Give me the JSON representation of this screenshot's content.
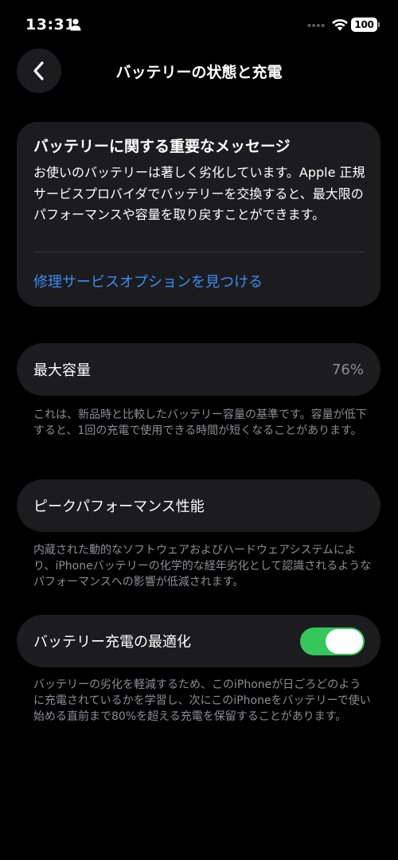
{
  "status_bar": {
    "time": "13:31",
    "battery_level": "100",
    "icons": [
      "person-icon",
      "signal-dots-icon",
      "wifi-icon",
      "battery-icon"
    ]
  },
  "nav": {
    "title": "バッテリーの状態と充電",
    "back_icon": "chevron-left-icon"
  },
  "message_card": {
    "title": "バッテリーに関する重要なメッセージ",
    "body": "お使いのバッテリーは著しく劣化しています。Apple 正規サービスプロバイダでバッテリーを交換すると、最大限のパフォーマンスや容量を取り戻すことができます。",
    "link": "修理サービスオプションを見つける"
  },
  "capacity": {
    "label": "最大容量",
    "value": "76%",
    "note": "これは、新品時と比較したバッテリー容量の基準です。容量が低下すると、1回の充電で使用できる時間が短くなることがあります。"
  },
  "peak_performance": {
    "label": "ピークパフォーマンス性能",
    "note": "内蔵された動的なソフトウェアおよびハードウェアシステムにより、iPhoneバッテリーの化学的な経年劣化として認識されるようなパフォーマンスへの影響が低減されます。"
  },
  "optimization": {
    "label": "バッテリー充電の最適化",
    "enabled": true,
    "note": "バッテリーの劣化を軽減するため、このiPhoneが日ごろどのように充電されているかを学習し、次にこのiPhoneをバッテリーで使い始める直前まで80%を超える充電を保留することがあります。"
  },
  "colors": {
    "background": "#000000",
    "card": "#1c1c1e",
    "link": "#3b8cf6",
    "secondary_text": "#8e8e93",
    "toggle_on": "#34c759"
  }
}
